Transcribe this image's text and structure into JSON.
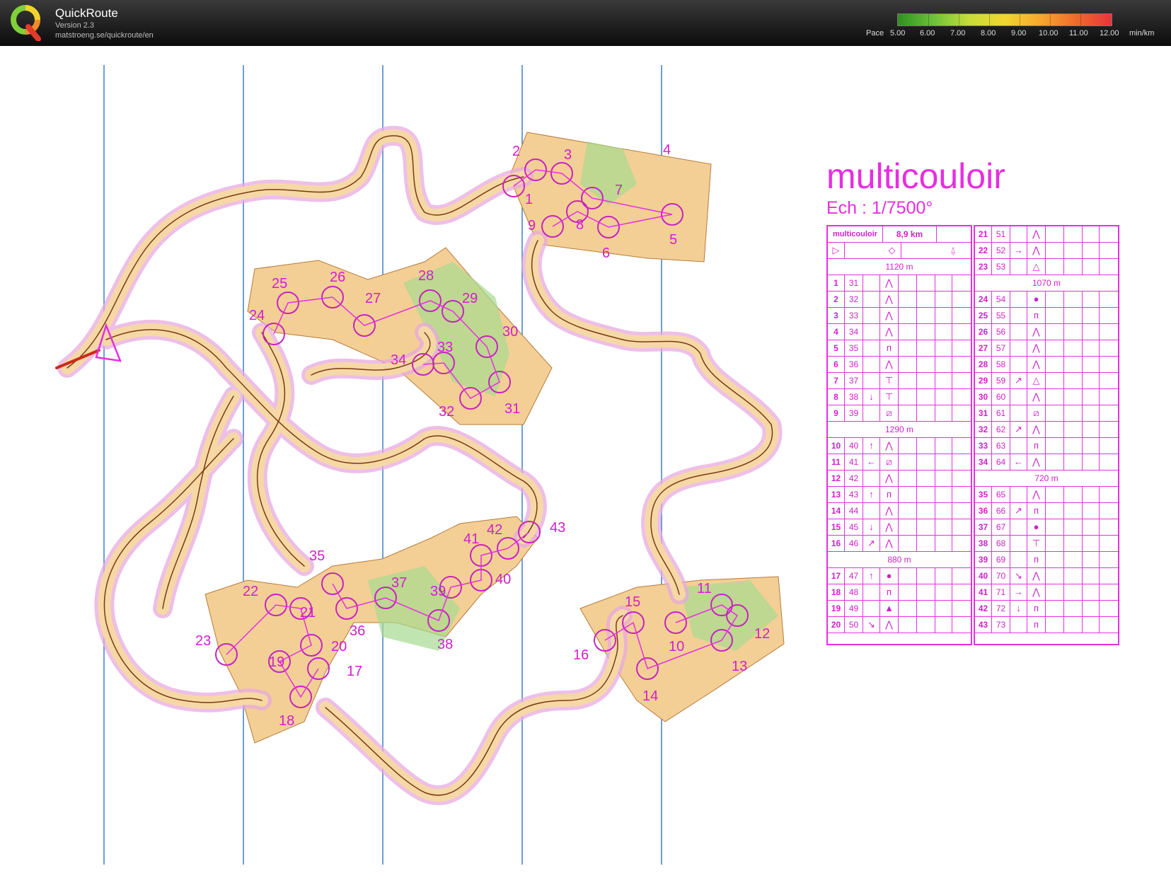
{
  "header": {
    "app_name": "QuickRoute",
    "version": "Version 2.3",
    "url": "matstroeng.se/quickroute/en",
    "pace_label": "Pace",
    "pace_ticks": [
      "5.00",
      "6.00",
      "7.00",
      "8.00",
      "9.00",
      "10.00",
      "11.00",
      "12.00",
      "min/km"
    ]
  },
  "colors": {
    "header_bg": "#111111",
    "course_magenta": "#e62fe0",
    "meridian_blue": "#3f7fc8",
    "map_orange": "#f5c88a",
    "map_green": "#9fd98a",
    "route_brown": "#7a3a10"
  },
  "map": {
    "control_labels": [
      "1",
      "2",
      "3",
      "4",
      "5",
      "6",
      "7",
      "8",
      "9",
      "10",
      "11",
      "12",
      "13",
      "14",
      "15",
      "16",
      "17",
      "18",
      "19",
      "20",
      "21",
      "22",
      "23",
      "24",
      "25",
      "26",
      "27",
      "28",
      "29",
      "30",
      "31",
      "32",
      "33",
      "34",
      "35",
      "36",
      "37",
      "38",
      "39",
      "40",
      "41",
      "42",
      "43"
    ]
  },
  "description": {
    "title": "multicouloir",
    "scale": "Ech : 1/7500°",
    "event_name": "multicouloir",
    "length": "8,9 km",
    "legs": [
      "1120 m",
      "1290 m",
      "880 m",
      "1070 m",
      "720 m"
    ],
    "left_column": [
      {
        "n": "1",
        "code": "31",
        "s1": "",
        "s2": "⋀"
      },
      {
        "n": "2",
        "code": "32",
        "s1": "",
        "s2": "⋀"
      },
      {
        "n": "3",
        "code": "33",
        "s1": "",
        "s2": "⋀"
      },
      {
        "n": "4",
        "code": "34",
        "s1": "",
        "s2": "⋀"
      },
      {
        "n": "5",
        "code": "35",
        "s1": "",
        "s2": "ᴨ"
      },
      {
        "n": "6",
        "code": "36",
        "s1": "",
        "s2": "⋀"
      },
      {
        "n": "7",
        "code": "37",
        "s1": "",
        "s2": "⊤"
      },
      {
        "n": "8",
        "code": "38",
        "s1": "↓",
        "s2": "⊤"
      },
      {
        "n": "9",
        "code": "39",
        "s1": "",
        "s2": "⧄"
      },
      {
        "n": "10",
        "code": "40",
        "s1": "↑",
        "s2": "⋀"
      },
      {
        "n": "11",
        "code": "41",
        "s1": "←",
        "s2": "⧄"
      },
      {
        "n": "12",
        "code": "42",
        "s1": "",
        "s2": "⋀"
      },
      {
        "n": "13",
        "code": "43",
        "s1": "↑",
        "s2": "ᴨ"
      },
      {
        "n": "14",
        "code": "44",
        "s1": "",
        "s2": "⋀"
      },
      {
        "n": "15",
        "code": "45",
        "s1": "↓",
        "s2": "⋀"
      },
      {
        "n": "16",
        "code": "46",
        "s1": "↗",
        "s2": "⋀"
      },
      {
        "n": "17",
        "code": "47",
        "s1": "↑",
        "s2": "●"
      },
      {
        "n": "18",
        "code": "48",
        "s1": "",
        "s2": "ᴨ"
      },
      {
        "n": "19",
        "code": "49",
        "s1": "",
        "s2": "▲"
      },
      {
        "n": "20",
        "code": "50",
        "s1": "↘",
        "s2": "⋀"
      }
    ],
    "right_column": [
      {
        "n": "21",
        "code": "51",
        "s1": "",
        "s2": "⋀"
      },
      {
        "n": "22",
        "code": "52",
        "s1": "→",
        "s2": "⋀"
      },
      {
        "n": "23",
        "code": "53",
        "s1": "",
        "s2": "△"
      },
      {
        "n": "24",
        "code": "54",
        "s1": "",
        "s2": "●"
      },
      {
        "n": "25",
        "code": "55",
        "s1": "",
        "s2": "ᴨ"
      },
      {
        "n": "26",
        "code": "56",
        "s1": "",
        "s2": "⋀"
      },
      {
        "n": "27",
        "code": "57",
        "s1": "",
        "s2": "⋀"
      },
      {
        "n": "28",
        "code": "58",
        "s1": "",
        "s2": "⋀"
      },
      {
        "n": "29",
        "code": "59",
        "s1": "↗",
        "s2": "△"
      },
      {
        "n": "30",
        "code": "60",
        "s1": "",
        "s2": "⋀"
      },
      {
        "n": "31",
        "code": "61",
        "s1": "",
        "s2": "⧄"
      },
      {
        "n": "32",
        "code": "62",
        "s1": "↗",
        "s2": "⋀"
      },
      {
        "n": "33",
        "code": "63",
        "s1": "",
        "s2": "ᴨ"
      },
      {
        "n": "34",
        "code": "64",
        "s1": "←",
        "s2": "⋀"
      },
      {
        "n": "35",
        "code": "65",
        "s1": "",
        "s2": "⋀"
      },
      {
        "n": "36",
        "code": "66",
        "s1": "↗",
        "s2": "ᴨ"
      },
      {
        "n": "37",
        "code": "67",
        "s1": "",
        "s2": "●"
      },
      {
        "n": "38",
        "code": "68",
        "s1": "",
        "s2": "⊤"
      },
      {
        "n": "39",
        "code": "69",
        "s1": "",
        "s2": "ᴨ"
      },
      {
        "n": "40",
        "code": "70",
        "s1": "↘",
        "s2": "⋀"
      },
      {
        "n": "41",
        "code": "71",
        "s1": "→",
        "s2": "⋀"
      },
      {
        "n": "42",
        "code": "72",
        "s1": "↓",
        "s2": "ᴨ"
      },
      {
        "n": "43",
        "code": "73",
        "s1": "",
        "s2": "ᴨ"
      }
    ]
  }
}
